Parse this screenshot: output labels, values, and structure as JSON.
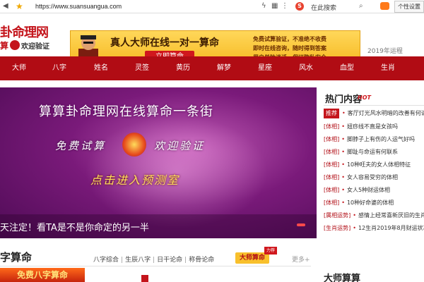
{
  "browser": {
    "url": "https://www.suansuangua.com",
    "search_placeholder": "在此搜索",
    "personal_settings": "个性设置"
  },
  "header": {
    "logo_main": "卦命理网",
    "logo_sub_left": "算",
    "logo_sub_right": "欢迎验证",
    "ad_title": "真人大师在线一对一算命",
    "ad_button": "立即算命",
    "ad_desc_lines": [
      "免费试算验证，不准绝不收费",
      "即时在线咨询，随时得到答案",
      "用户单独谈话，保证隐私安全"
    ],
    "yun_tab": "2019年运程"
  },
  "nav": {
    "items": [
      "大师",
      "八字",
      "姓名",
      "灵签",
      "黄历",
      "解梦",
      "星座",
      "风水",
      "血型",
      "生肖",
      "个性设置"
    ]
  },
  "hero": {
    "title": "算算卦命理网在线算命一条街",
    "free_text": "免费试算",
    "welcome_text": "欢迎验证",
    "enter_text": "点击进入预测室",
    "caption": "天注定！看TA是不是你命定的另一半"
  },
  "hot": {
    "title": "热门内容",
    "badge": "HOT",
    "rows": [
      {
        "tag": "推荐",
        "text": "客厅灯光风水明暗的改善有何讲究"
      },
      {
        "tag": "[体相]",
        "text": "妞痧线不直是女孩吗"
      },
      {
        "tag": "[体相]",
        "text": "脚脖子上有伤的人运气好吗"
      },
      {
        "tag": "[体相]",
        "text": "脚趾与命运有何联系"
      },
      {
        "tag": "[体相]",
        "text": "10种旺夫的女人体相特征"
      },
      {
        "tag": "[体相]",
        "text": "女人容易受穷的体相"
      },
      {
        "tag": "[体相]",
        "text": "女人5种财运体相"
      },
      {
        "tag": "[体相]",
        "text": "10种好命婆的体相"
      },
      {
        "tag": "[属相运势]",
        "text": "感情上经常喜新厌旧的生肖"
      },
      {
        "tag": "[生肖运势]",
        "text": "12生肖2019年8月财运状况"
      }
    ]
  },
  "section": {
    "title": "字算命",
    "tabs": [
      "八字综合",
      "生辰八字",
      "日干论命",
      "称骨论命"
    ],
    "badge": "大师算命",
    "badge_top": "力荐",
    "more": "更多+",
    "free_bazi": "免费八字算命",
    "master_title": "大师算算"
  },
  "colors": {
    "brand_red": "#b10c14",
    "ad_yellow": "#f6b921",
    "hero_purple": "#7a1a7a"
  }
}
